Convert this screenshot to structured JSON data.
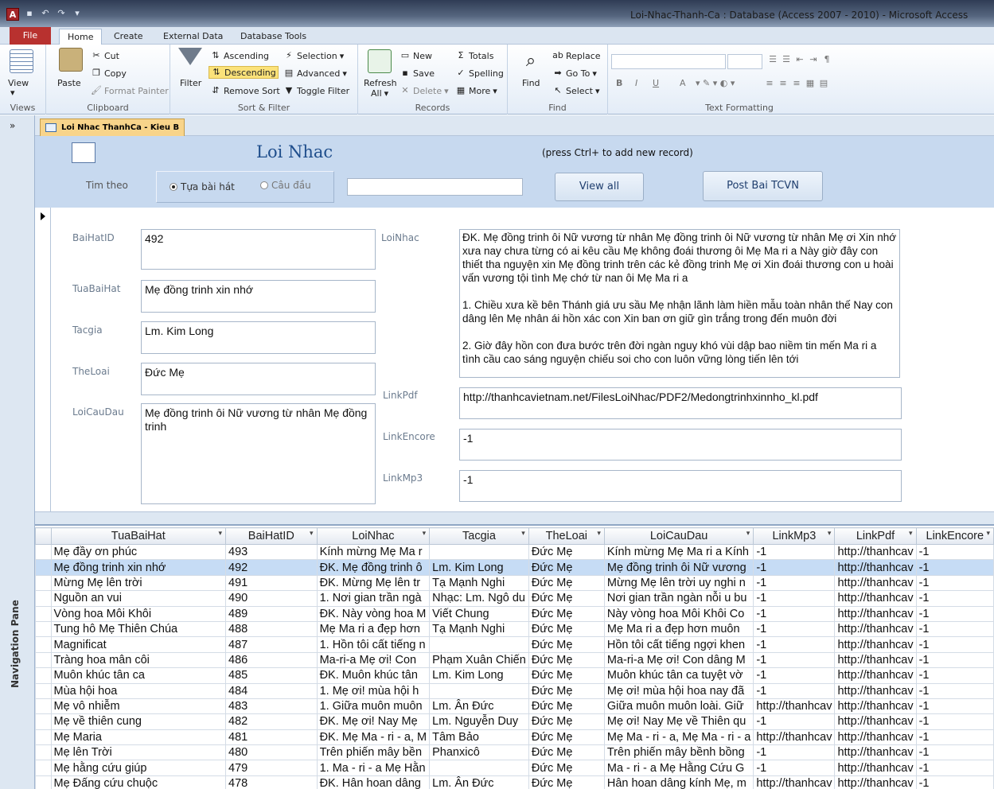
{
  "window": {
    "title": "Loi-Nhac-Thanh-Ca : Database (Access 2007 - 2010)  -  Microsoft Access",
    "app_icon": "A"
  },
  "ribbon_tabs": [
    "File",
    "Home",
    "Create",
    "External Data",
    "Database Tools"
  ],
  "ribbon": {
    "views": {
      "view": "View",
      "label": "Views"
    },
    "clipboard": {
      "paste": "Paste",
      "cut": "Cut",
      "copy": "Copy",
      "format_painter": "Format Painter",
      "label": "Clipboard"
    },
    "sort_filter": {
      "filter": "Filter",
      "ascending": "Ascending",
      "descending": "Descending",
      "remove_sort": "Remove Sort",
      "selection": "Selection",
      "advanced": "Advanced",
      "toggle_filter": "Toggle Filter",
      "label": "Sort & Filter"
    },
    "records": {
      "refresh": "Refresh",
      "refresh_all": "All",
      "new": "New",
      "save": "Save",
      "delete": "Delete",
      "totals": "Totals",
      "spelling": "Spelling",
      "more": "More",
      "label": "Records"
    },
    "find": {
      "find": "Find",
      "replace": "Replace",
      "goto": "Go To",
      "select": "Select",
      "label": "Find"
    },
    "text_formatting": {
      "bold": "B",
      "italic": "I",
      "underline": "U",
      "font_color": "A",
      "label": "Text Formatting"
    }
  },
  "nav_pane": {
    "label": "Navigation Pane",
    "toggle": "»"
  },
  "doc_tab": {
    "label": "Loi Nhac ThanhCa - Kieu B"
  },
  "form_header": {
    "title": "Loi Nhac",
    "hint": "(press Ctrl+ to add new record)",
    "search_label": "Tim theo",
    "radio1": "Tựa bài hát",
    "radio2": "Câu đầu",
    "search_value": "",
    "view_all": "View all",
    "post": "Post Bai TCVN"
  },
  "record": {
    "labels": {
      "id": "BaiHatID",
      "tua": "TuaBaiHat",
      "tacgia": "Tacgia",
      "theloai": "TheLoai",
      "loicaudau": "LoiCauDau",
      "loinhac": "LoiNhac",
      "linkpdf": "LinkPdf",
      "linkencore": "LinkEncore",
      "linkmp3": "LinkMp3"
    },
    "id": "492",
    "tua": "Mẹ đồng trinh xin nhớ",
    "tacgia": "Lm. Kim Long",
    "theloai": "Đức Mẹ",
    "loicaudau": "Mẹ đồng trinh ôi Nữ vương từ nhân Mẹ đồng trinh",
    "loinhac": "ĐK. Mẹ đồng trinh ôi Nữ vương từ nhân Mẹ đồng trinh ôi Nữ vương từ nhân Mẹ ơi Xin nhớ xưa nay chưa từng có ai kêu cầu Mẹ không đoái thương ôi Mẹ Ma ri a Này giờ đây con thiết tha nguyện xin Mẹ đồng trinh trên các kẻ đồng trinh Mẹ ơi Xin đoái thương con u hoài vấn vương tội tình Mẹ chớ từ nan ôi Mẹ Ma ri a\n\n1. Chiều xưa kề bên Thánh giá ưu sầu Mẹ nhận lãnh làm hiền mẫu toàn nhân thế Nay con dâng lên Mẹ nhân ái hồn xác con Xin ban ơn giữ gìn trắng trong đến muôn đời\n\n2. Giờ đây hồn con đưa bước trên đời ngàn nguy khó vùi dập bao niềm tin mến Ma ri a tình cầu cao sáng nguyện chiếu soi cho con luôn vững lòng tiến lên tới",
    "linkpdf": "http://thanhcavietnam.net/FilesLoiNhac/PDF2/Medongtrinhxinnho_kl.pdf",
    "linkencore": "-1",
    "linkmp3": "-1"
  },
  "datasheet": {
    "columns": [
      "TuaBaiHat",
      "BaiHatID",
      "LoiNhac",
      "Tacgia",
      "TheLoai",
      "LoiCauDau",
      "LinkMp3",
      "LinkPdf",
      "LinkEncore"
    ],
    "rows": [
      [
        "Mẹ đầy ơn phúc",
        "493",
        "Kính mừng Mẹ Ma r",
        "",
        "Đức Mẹ",
        "Kính mừng Mẹ Ma ri a Kính",
        "-1",
        "http://thanhcav",
        "-1"
      ],
      [
        "Mẹ đồng trinh xin nhớ",
        "492",
        "ĐK. Mẹ đồng trinh ô",
        "Lm. Kim Long",
        "Đức Mẹ",
        "Mẹ đồng trinh ôi Nữ vương",
        "-1",
        "http://thanhcav",
        "-1"
      ],
      [
        "Mừng Mẹ lên trời",
        "491",
        "ĐK. Mừng Mẹ lên tr",
        "Tạ Mạnh Nghi",
        "Đức Mẹ",
        "Mừng Mẹ lên trời uy nghi n",
        "-1",
        "http://thanhcav",
        "-1"
      ],
      [
        "Nguồn an vui",
        "490",
        "1. Nơi gian trần ngà",
        "Nhạc: Lm. Ngô du",
        "Đức Mẹ",
        "Nơi gian trần ngàn nỗi u bu",
        "-1",
        "http://thanhcav",
        "-1"
      ],
      [
        "Vòng hoa Môi Khôi",
        "489",
        "ĐK. Này vòng hoa M",
        "Viết Chung",
        "Đức Mẹ",
        "Này vòng hoa Môi Khôi Co",
        "-1",
        "http://thanhcav",
        "-1"
      ],
      [
        "Tung hô Mẹ Thiên Chúa",
        "488",
        "Mẹ Ma ri a đẹp hơn",
        "Tạ Mạnh Nghi",
        "Đức Mẹ",
        "Mẹ Ma ri a đẹp hơn muôn",
        "-1",
        "http://thanhcav",
        "-1"
      ],
      [
        "Magnificat",
        "487",
        "1. Hồn tôi cất tiếng n",
        "",
        "Đức Mẹ",
        "Hồn tôi cất tiếng ngợi khen",
        "-1",
        "http://thanhcav",
        "-1"
      ],
      [
        "Tràng hoa mân côi",
        "486",
        "Ma-ri-a Mẹ ơi! Con",
        "Phạm Xuân Chiến",
        "Đức Mẹ",
        "Ma-ri-a Mẹ ơi! Con dâng M",
        "-1",
        "http://thanhcav",
        "-1"
      ],
      [
        "Muôn khúc tân ca",
        "485",
        "ĐK. Muôn khúc tân",
        "Lm. Kim Long",
        "Đức Mẹ",
        "Muôn khúc tân ca tuyệt vờ",
        "-1",
        "http://thanhcav",
        "-1"
      ],
      [
        "Mùa hội hoa",
        "484",
        "1. Mẹ ơi! mùa hội h",
        "",
        "Đức Mẹ",
        "Mẹ ơi! mùa hội hoa nay đã",
        "-1",
        "http://thanhcav",
        "-1"
      ],
      [
        "Mẹ vô nhiễm",
        "483",
        "1. Giữa muôn muôn",
        "Lm. Ân Đức",
        "Đức Mẹ",
        "Giữa muôn muôn loài. Giữ",
        "http://thanhcav",
        "http://thanhcav",
        "-1"
      ],
      [
        "Mẹ về thiên cung",
        "482",
        "ĐK. Mẹ ơi! Nay Mẹ",
        "Lm. Nguyễn Duy",
        "Đức Mẹ",
        "Mẹ ơi! Nay Mẹ về Thiên qu",
        "-1",
        "http://thanhcav",
        "-1"
      ],
      [
        "Mẹ Maria",
        "481",
        "ĐK. Mẹ Ma - ri - a, M",
        "Tâm Bảo",
        "Đức Mẹ",
        "Mẹ Ma - ri - a, Mẹ Ma - ri - a",
        "http://thanhcav",
        "http://thanhcav",
        "-1"
      ],
      [
        "Mẹ lên Trời",
        "480",
        "Trên phiến mây bền",
        "Phanxicô",
        "Đức Mẹ",
        "Trên phiến mây bềnh bồng",
        "-1",
        "http://thanhcav",
        "-1"
      ],
      [
        "Mẹ hằng cứu giúp",
        "479",
        "1. Ma - ri - a Mẹ Hằn",
        "",
        "Đức Mẹ",
        "Ma - ri - a Mẹ Hằng Cứu G",
        "-1",
        "http://thanhcav",
        "-1"
      ],
      [
        "Mẹ Đấng cứu chuộc",
        "478",
        "ĐK. Hân hoan dâng",
        "Lm. Ân Đức",
        "Đức Mẹ",
        "Hân hoan dâng kính Mẹ, m",
        "http://thanhcav",
        "http://thanhcav",
        "-1"
      ]
    ],
    "selected_index": 1
  }
}
